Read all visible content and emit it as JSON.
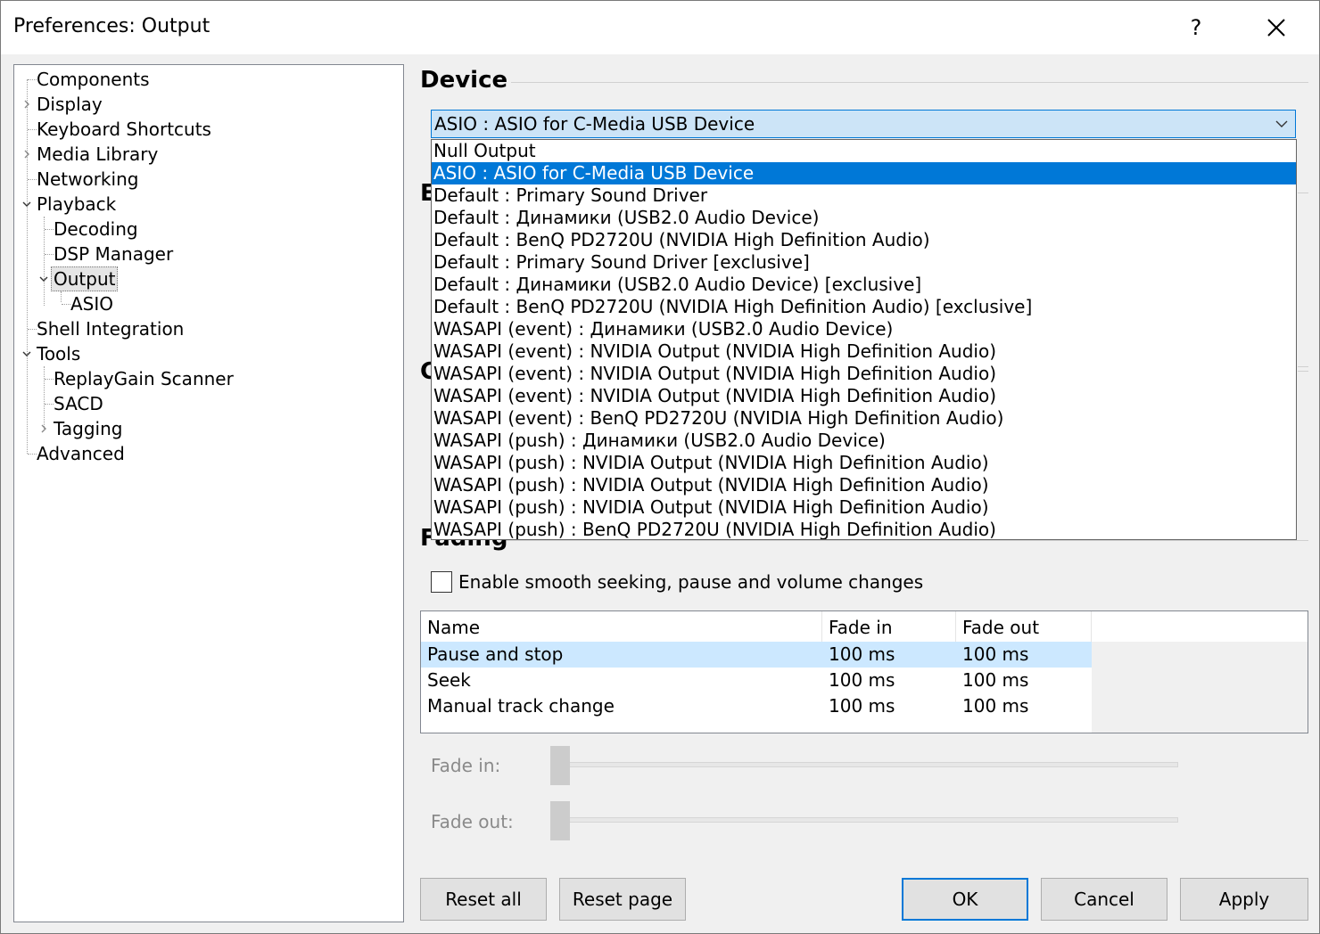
{
  "window": {
    "title": "Preferences: Output",
    "help_glyph": "?"
  },
  "tree": {
    "items": [
      {
        "label": "Components"
      },
      {
        "label": "Display"
      },
      {
        "label": "Keyboard Shortcuts"
      },
      {
        "label": "Media Library"
      },
      {
        "label": "Networking"
      },
      {
        "label": "Playback"
      },
      {
        "label": "Decoding"
      },
      {
        "label": "DSP Manager"
      },
      {
        "label": "Output"
      },
      {
        "label": "ASIO"
      },
      {
        "label": "Shell Integration"
      },
      {
        "label": "Tools"
      },
      {
        "label": "ReplayGain Scanner"
      },
      {
        "label": "SACD"
      },
      {
        "label": "Tagging"
      },
      {
        "label": "Advanced"
      }
    ]
  },
  "device": {
    "group_title": "Device",
    "selected": "ASIO : ASIO for C-Media USB Device",
    "options": [
      "Null Output",
      "ASIO : ASIO for C-Media USB Device",
      "Default : Primary Sound Driver",
      "Default : Динамики (USB2.0 Audio Device)",
      "Default : BenQ PD2720U (NVIDIA High Definition Audio)",
      "Default : Primary Sound Driver [exclusive]",
      "Default : Динамики (USB2.0 Audio Device) [exclusive]",
      "Default : BenQ PD2720U (NVIDIA High Definition Audio) [exclusive]",
      "WASAPI (event) : Динамики (USB2.0 Audio Device)",
      "WASAPI (event) : NVIDIA Output (NVIDIA High Definition Audio)",
      "WASAPI (event) : NVIDIA Output (NVIDIA High Definition Audio)",
      "WASAPI (event) : NVIDIA Output (NVIDIA High Definition Audio)",
      "WASAPI (event) : BenQ PD2720U (NVIDIA High Definition Audio)",
      "WASAPI (push) : Динамики (USB2.0 Audio Device)",
      "WASAPI (push) : NVIDIA Output (NVIDIA High Definition Audio)",
      "WASAPI (push) : NVIDIA Output (NVIDIA High Definition Audio)",
      "WASAPI (push) : NVIDIA Output (NVIDIA High Definition Audio)",
      "WASAPI (push) : BenQ PD2720U (NVIDIA High Definition Audio)"
    ],
    "selected_index": 1
  },
  "hidden_groups": {
    "peek_1": "E",
    "peek_2": "C",
    "fading_title": "Fading"
  },
  "fading": {
    "smooth_label": "Enable smooth seeking, pause and volume changes",
    "smooth_checked": false,
    "columns": [
      "Name",
      "Fade in",
      "Fade out"
    ],
    "rows": [
      {
        "name": "Pause and stop",
        "fade_in": "100 ms",
        "fade_out": "100 ms"
      },
      {
        "name": "Seek",
        "fade_in": "100 ms",
        "fade_out": "100 ms"
      },
      {
        "name": "Manual track change",
        "fade_in": "100 ms",
        "fade_out": "100 ms"
      }
    ],
    "selected_row": 0,
    "fade_in_label": "Fade in:",
    "fade_out_label": "Fade out:",
    "fade_in_level": 0,
    "fade_out_level": 0
  },
  "buttons": {
    "reset_all": "Reset all",
    "reset_page": "Reset page",
    "ok": "OK",
    "cancel": "Cancel",
    "apply": "Apply"
  }
}
